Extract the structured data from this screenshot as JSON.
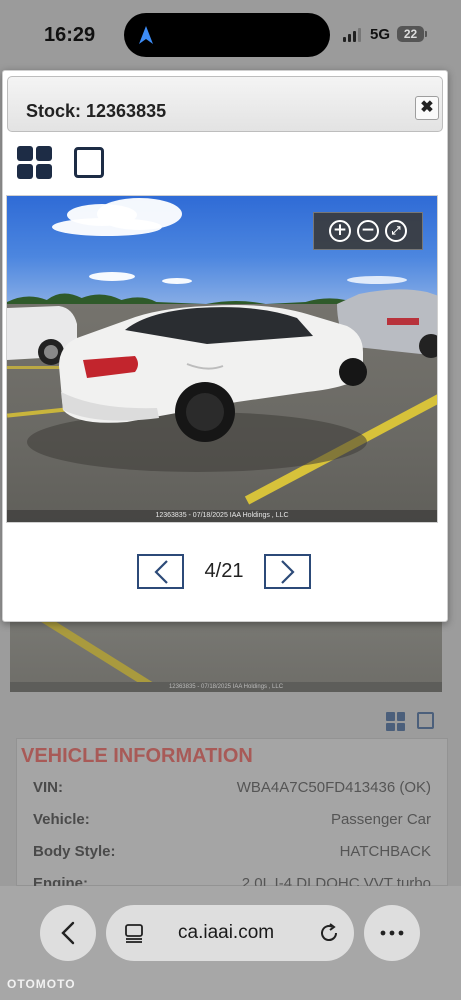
{
  "status_bar": {
    "time": "16:29",
    "network": "5G",
    "battery": "22"
  },
  "modal": {
    "title": "Stock: 12363835",
    "close_label": "✖",
    "photo_caption": "12363835 - 07/18/2025 IAA Holdings , LLC",
    "pager_text": "4/21"
  },
  "background_page": {
    "photo_caption": "12363835 - 07/18/2025 IAA Holdings , LLC",
    "section_title": "VEHICLE INFORMATION",
    "rows": [
      {
        "label": "VIN:",
        "value": "WBA4A7C50FD413436 (OK)"
      },
      {
        "label": "Vehicle:",
        "value": "Passenger Car"
      },
      {
        "label": "Body Style:",
        "value": "HATCHBACK"
      },
      {
        "label": "Engine:",
        "value": "2.0L  I-4  DI  DOHC  VVT  turbo"
      }
    ]
  },
  "browser": {
    "url": "ca.iaai.com"
  },
  "watermark": "OTOMOTO",
  "colors": {
    "accent_navy": "#1d2c45",
    "pager_border": "#2c4a78",
    "section_title": "#a85a57"
  },
  "icons": [
    "navigation-arrow-icon",
    "grid-view-icon",
    "single-view-icon",
    "zoom-in-icon",
    "zoom-out-icon",
    "fullscreen-icon",
    "chevron-left-icon",
    "chevron-right-icon",
    "back-icon",
    "tabs-icon",
    "reload-icon",
    "more-icon"
  ]
}
